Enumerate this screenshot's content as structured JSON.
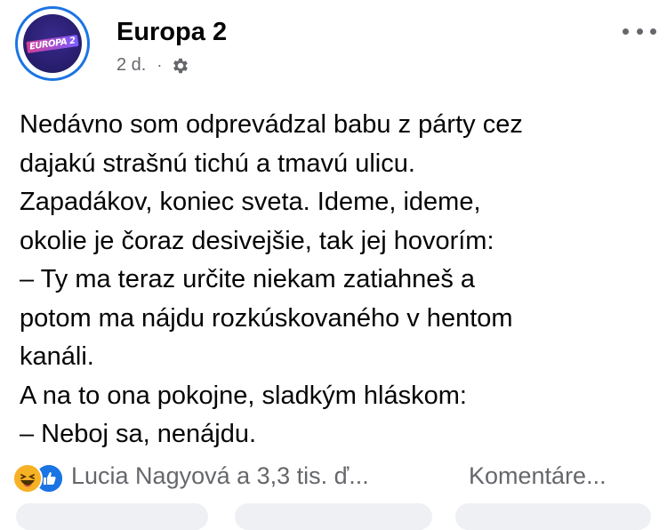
{
  "post": {
    "author": "Europa 2",
    "avatar_logo_text": "EUROPA 2",
    "time": "2 d.",
    "separator": "·",
    "privacy_icon": "gear-icon",
    "lines": [
      "Nedávno som odprevádzal babu z párty cez",
      "dajakú strašnú tichú a tmavú ulicu.",
      "Zapadákov, koniec sveta. Ideme, ideme,",
      "okolie je čoraz desivejšie, tak jej hovorím:",
      "– Ty ma teraz určite niekam zatiahneš a",
      "potom ma nájdu rozkúskovaného v hentom",
      "kanáli.",
      "A na to ona pokojne, sladkým hláskom:",
      "– Neboj sa, nenájdu."
    ]
  },
  "footer": {
    "reaction_icons": [
      "haha-icon",
      "like-icon"
    ],
    "reactions_text": "Lucia Nagyová a 3,3 tis. ď...",
    "comments_text": "Komentáre..."
  },
  "colors": {
    "text": "#050505",
    "secondary": "#65676b",
    "accent_blue": "#1b74e4",
    "haha_yellow": "#f7b125"
  }
}
